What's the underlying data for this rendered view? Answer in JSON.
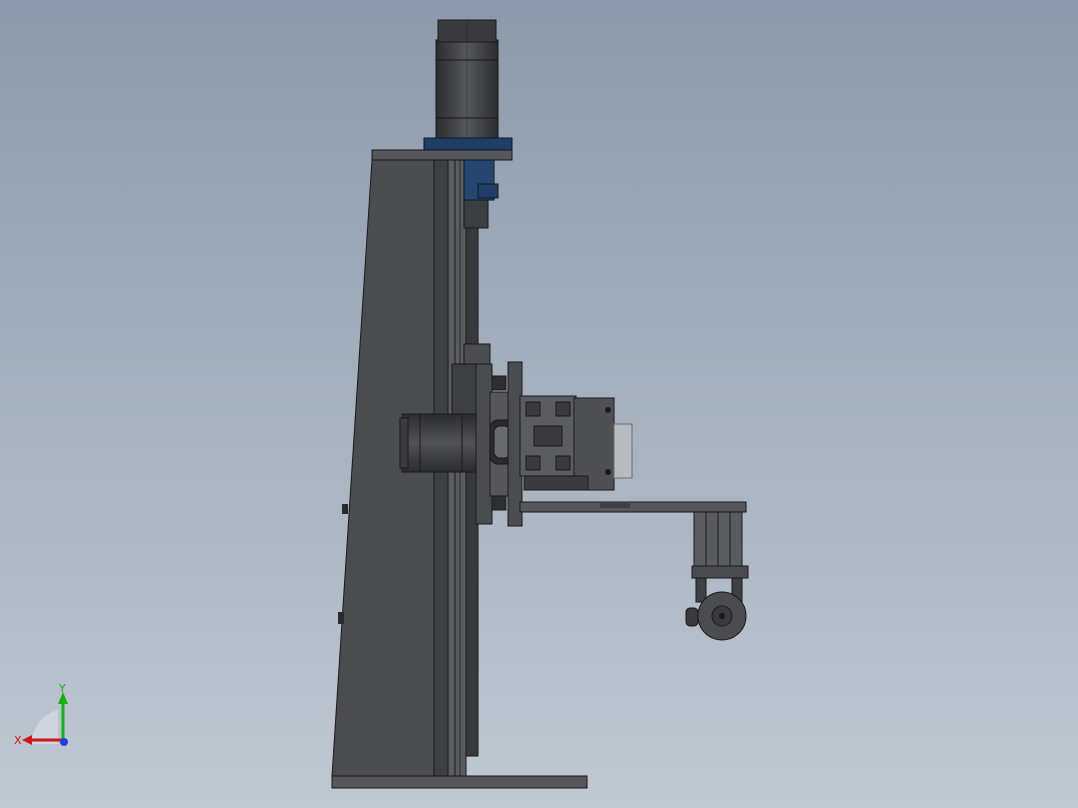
{
  "viewport": {
    "background_top": "#8c9aab",
    "background_bottom": "#c0c8d2"
  },
  "model": {
    "body_color": "#4a4c50",
    "edge_color": "#1a1a1c",
    "accent_color": "#1f3f66"
  },
  "triad": {
    "x_label": "X",
    "y_label": "Y",
    "x_color": "#d01818",
    "y_color": "#18b018",
    "z_color": "#2040e0"
  }
}
